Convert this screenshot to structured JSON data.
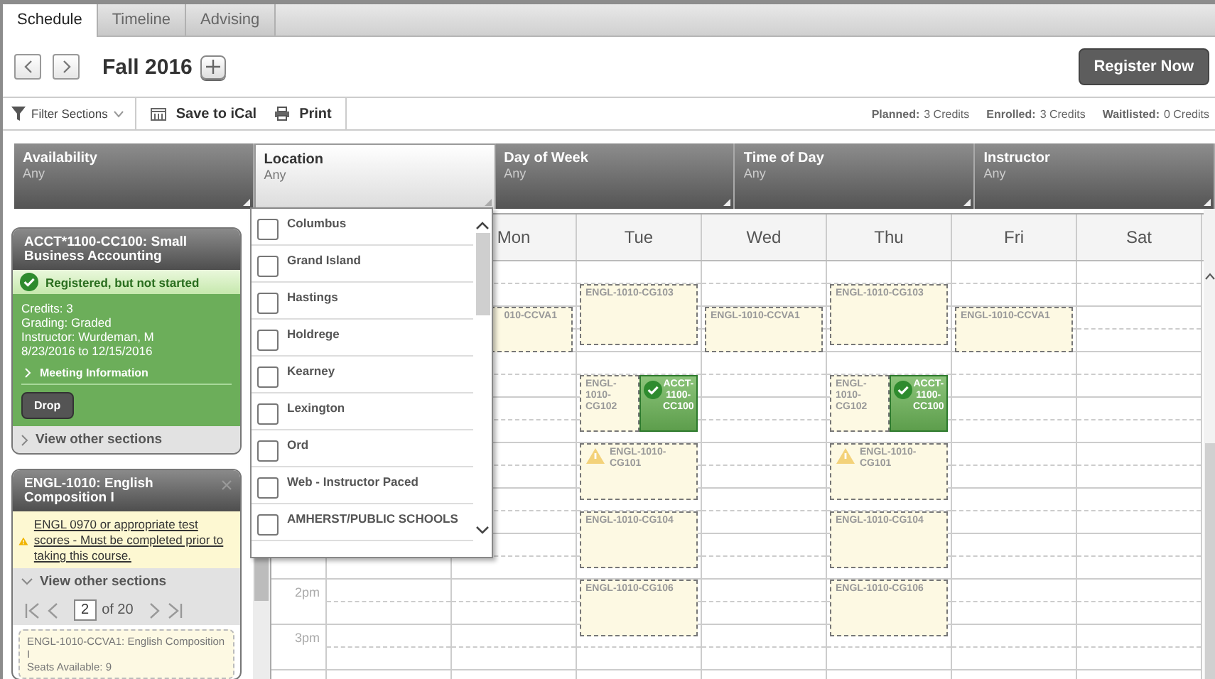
{
  "tabs": [
    {
      "label": "Schedule",
      "selected": true
    },
    {
      "label": "Timeline",
      "selected": false
    },
    {
      "label": "Advising",
      "selected": false
    }
  ],
  "term": {
    "title": "Fall 2016",
    "register_button": "Register Now"
  },
  "toolbar": {
    "filter": "Filter Sections",
    "actions": [
      {
        "kind": "ical",
        "label": "Save to iCal"
      },
      {
        "kind": "print",
        "label": "Print"
      }
    ],
    "credits": [
      {
        "label": "Planned:",
        "value": "3 Credits"
      },
      {
        "label": "Enrolled:",
        "value": "3 Credits"
      },
      {
        "label": "Waitlisted:",
        "value": "0 Credits"
      }
    ]
  },
  "filters": [
    {
      "label": "Availability",
      "value": "Any",
      "selected": false
    },
    {
      "label": "Location",
      "value": "Any",
      "selected": true
    },
    {
      "label": "Day of Week",
      "value": "Any",
      "selected": false
    },
    {
      "label": "Time of Day",
      "value": "Any",
      "selected": false
    },
    {
      "label": "Instructor",
      "value": "Any",
      "selected": false
    }
  ],
  "location_options": [
    {
      "label": "Columbus",
      "checked": false
    },
    {
      "label": "Grand Island",
      "checked": false
    },
    {
      "label": "Hastings",
      "checked": false
    },
    {
      "label": "Holdrege",
      "checked": false
    },
    {
      "label": "Kearney",
      "checked": false
    },
    {
      "label": "Lexington",
      "checked": false
    },
    {
      "label": "Ord",
      "checked": false
    },
    {
      "label": "Web - Instructor Paced",
      "checked": false
    },
    {
      "label": "AMHERST/PUBLIC SCHOOLS",
      "checked": false
    }
  ],
  "courses": [
    {
      "kind": "registered",
      "title": "ACCT*1100-CC100: Small Business Accounting",
      "status": "Registered, but not started",
      "details": [
        "Credits: 3",
        "Grading: Graded",
        "Instructor: Wurdeman, M",
        "8/23/2016 to 12/15/2016"
      ],
      "meeting_info": "Meeting Information",
      "action": "Drop",
      "sections_link": "View other sections",
      "sections_expanded": false
    },
    {
      "kind": "planned",
      "title": "ENGL-1010: English Composition I",
      "warning": "ENGL 0970 or appropriate test scores - Must be completed prior to taking this course.",
      "sections_link": "View other sections",
      "sections_expanded": true,
      "pager": {
        "page": "2",
        "total": "of 20"
      },
      "sections": [
        {
          "title": "ENGL-1010-CCVA1: English Composition I",
          "seats": "Seats Available: 9"
        }
      ]
    }
  ],
  "calendar": {
    "time_labels": [
      "2pm",
      "3pm"
    ],
    "days": [
      {
        "name": "Mon",
        "events": [
          {
            "code": "010-CCVA1",
            "kind": "planned",
            "clipped": true
          }
        ]
      },
      {
        "name": "Tue",
        "events": [
          {
            "code": "ENGL-1010-CG103",
            "kind": "planned",
            "warning": false
          },
          {
            "code": "ENGL-1010-CG102",
            "kind": "planned",
            "warning": false
          },
          {
            "code": "ACCT-1100-CC100",
            "kind": "registered"
          },
          {
            "code": "ENGL-1010-CG101",
            "kind": "planned",
            "warning": true
          },
          {
            "code": "ENGL-1010-CG104",
            "kind": "planned",
            "warning": false
          },
          {
            "code": "ENGL-1010-CG106",
            "kind": "planned",
            "warning": false
          }
        ]
      },
      {
        "name": "Wed",
        "events": [
          {
            "code": "ENGL-1010-CCVA1",
            "kind": "planned",
            "clipped": false
          }
        ]
      },
      {
        "name": "Thu",
        "events": [
          {
            "code": "ENGL-1010-CG103",
            "kind": "planned",
            "warning": false
          },
          {
            "code": "ENGL-1010-CG102",
            "kind": "planned",
            "warning": false
          },
          {
            "code": "ACCT-1100-CC100",
            "kind": "registered"
          },
          {
            "code": "ENGL-1010-CG101",
            "kind": "planned",
            "warning": true
          },
          {
            "code": "ENGL-1010-CG104",
            "kind": "planned",
            "warning": false
          },
          {
            "code": "ENGL-1010-CG106",
            "kind": "planned",
            "warning": false
          }
        ]
      },
      {
        "name": "Fri",
        "events": [
          {
            "code": "ENGL-1010-CCVA1",
            "kind": "planned",
            "clipped": false
          }
        ]
      },
      {
        "name": "Sat"
      }
    ]
  }
}
